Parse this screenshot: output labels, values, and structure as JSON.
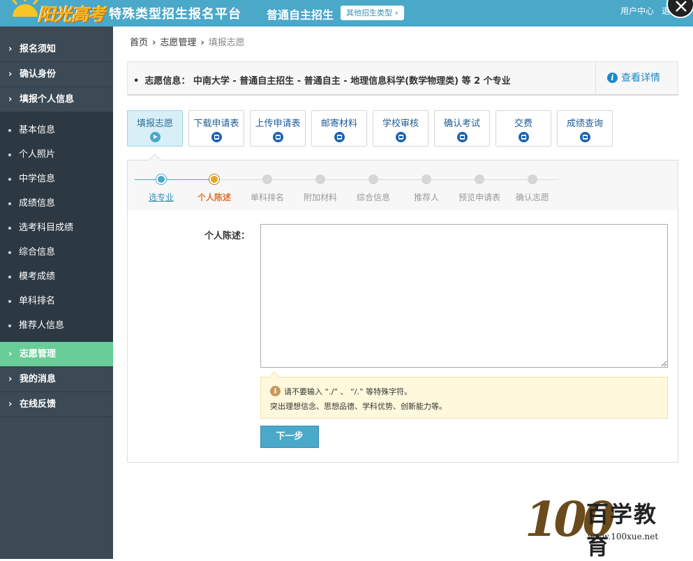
{
  "header": {
    "logo_text": "阳光高考",
    "platform_title": "特殊类型招生报名平台",
    "subtype": "普通自主招生",
    "other_type_button": "其他招生类型",
    "user_center": "用户中心",
    "logout": "退出",
    "brand_color": "#4aa8c9"
  },
  "sidebar": {
    "items": [
      {
        "label": "报名须知"
      },
      {
        "label": "确认身份"
      },
      {
        "label": "填报个人信息"
      }
    ],
    "sub_items": [
      {
        "label": "基本信息"
      },
      {
        "label": "个人照片"
      },
      {
        "label": "中学信息"
      },
      {
        "label": "成绩信息"
      },
      {
        "label": "选考科目成绩"
      },
      {
        "label": "综合信息"
      },
      {
        "label": "模考成绩"
      },
      {
        "label": "单科排名"
      },
      {
        "label": "推荐人信息"
      }
    ],
    "lower_items": [
      {
        "label": "志愿管理",
        "active": true
      },
      {
        "label": "我的消息"
      },
      {
        "label": "在线反馈"
      }
    ],
    "active_color": "#68cd98"
  },
  "breadcrumb": {
    "home": "首页",
    "level2": "志愿管理",
    "current": "填报志愿"
  },
  "info_bar": {
    "text": "志愿信息： 中南大学 - 普通自主招生 - 普通自主 - 地理信息科学(数学物理类) 等 2 个专业",
    "detail_link": "查看详情"
  },
  "tabs": [
    {
      "label": "填报志愿",
      "active": true
    },
    {
      "label": "下载申请表"
    },
    {
      "label": "上传申请表"
    },
    {
      "label": "邮寄材料"
    },
    {
      "label": "学校审核"
    },
    {
      "label": "确认考试"
    },
    {
      "label": "交费"
    },
    {
      "label": "成绩查询"
    }
  ],
  "steps": [
    {
      "label": "选专业",
      "state": "done"
    },
    {
      "label": "个人陈述",
      "state": "current"
    },
    {
      "label": "单科排名",
      "state": "todo"
    },
    {
      "label": "附加材料",
      "state": "todo"
    },
    {
      "label": "综合信息",
      "state": "todo"
    },
    {
      "label": "推荐人",
      "state": "todo"
    },
    {
      "label": "预览申请表",
      "state": "todo"
    },
    {
      "label": "确认志愿",
      "state": "todo"
    }
  ],
  "form": {
    "statement_label": "个人陈述：",
    "statement_value": "",
    "hint_line1": "请不要输入 “./” 、 “/.” 等特殊字符。",
    "hint_line2": "突出理想信念、思想品德、学科优势、创新能力等。",
    "next_button": "下一步"
  },
  "watermark": {
    "number": "100",
    "chinese": "百学教育",
    "url": "www.100xue.net"
  }
}
